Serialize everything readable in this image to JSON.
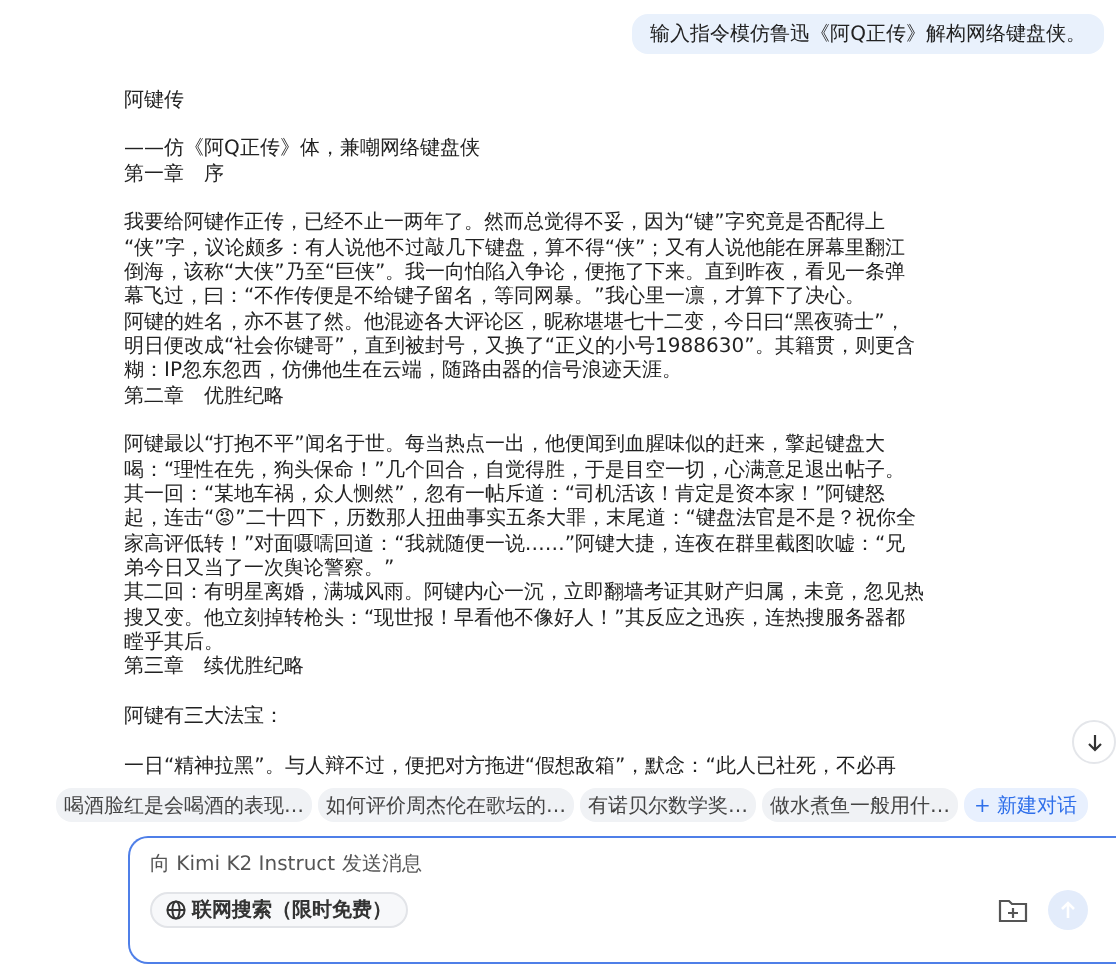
{
  "user_message": {
    "text": "输入指令模仿鲁迅《阿Q正传》解构网络键盘侠。"
  },
  "reply": [
    {
      "kind": "title",
      "text": "阿键传"
    },
    {
      "kind": "blank"
    },
    {
      "kind": "line",
      "text": "——仿《阿Q正传》体，兼嘲网络键盘侠"
    },
    {
      "kind": "chapter",
      "text": "第一章　序"
    },
    {
      "kind": "blank"
    },
    {
      "kind": "paragraph",
      "lines": [
        "我要给阿键作正传，已经不止一两年了。然而总觉得不妥，因为“键”字究竟是否配得上",
        "“侠”字，议论颇多：有人说他不过敲几下键盘，算不得“侠”；又有人说他能在屏幕里翻江",
        "倒海，该称“大侠”乃至“巨侠”。我一向怕陷入争论，便拖了下来。直到昨夜，看见一条弹",
        "幕飞过，曰：“不作传便是不给键子留名，等同网暴。”我心里一凛，才算下了决心。"
      ]
    },
    {
      "kind": "paragraph",
      "lines": [
        "阿键的姓名，亦不甚了然。他混迹各大评论区，昵称堪堪七十二变，今日曰“黑夜骑士”，",
        "明日便改成“社会你键哥”，直到被封号，又换了“正义的小号1988630”。其籍贯，则更含",
        "糊：IP忽东忽西，仿佛他生在云端，随路由器的信号浪迹天涯。"
      ]
    },
    {
      "kind": "chapter",
      "text": "第二章　优胜纪略"
    },
    {
      "kind": "blank"
    },
    {
      "kind": "paragraph",
      "lines": [
        "阿键最以“打抱不平”闻名于世。每当热点一出，他便闻到血腥味似的赶来，擎起键盘大",
        "喝：“理性在先，狗头保命！”几个回合，自觉得胜，于是目空一切，心满意足退出帖子。"
      ]
    },
    {
      "kind": "paragraph",
      "lines": [
        "其一回：“某地车祸，众人恻然”，忽有一帖斥道：“司机活该！肯定是资本家！”阿键怒",
        "起，连击“😡”二十四下，历数那人扭曲事实五条大罪，末尾道：“键盘法官是不是？祝你全",
        "家高评低转！”对面嗫嚅回道：“我就随便一说……”阿键大捷，连夜在群里截图吹嘘：“兄",
        "弟今日又当了一次舆论警察。”"
      ]
    },
    {
      "kind": "paragraph",
      "lines": [
        "其二回：有明星离婚，满城风雨。阿键内心一沉，立即翻墙考证其财产归属，未竟，忽见热",
        "搜又变。他立刻掉转枪头：“现世报！早看他不像好人！”其反应之迅疾，连热搜服务器都",
        "瞠乎其后。"
      ]
    },
    {
      "kind": "chapter",
      "text": "第三章　续优胜纪略"
    },
    {
      "kind": "blank"
    },
    {
      "kind": "line",
      "text": "阿键有三大法宝："
    },
    {
      "kind": "blank"
    },
    {
      "kind": "line",
      "text": "一日“精神拉黑”。与人辩不过，便把对方拖进“假想敌箱”，默念：“此人已社死，不必再"
    }
  ],
  "suggestions": [
    {
      "text": "喝酒脸红是会喝酒的表现…"
    },
    {
      "text": "如何评价周杰伦在歌坛的…"
    },
    {
      "text": "有诺贝尔数学奖…"
    },
    {
      "text": "做水煮鱼一般用什…"
    }
  ],
  "new_chat": {
    "label": "+ 新建对话"
  },
  "composer": {
    "placeholder": "向 Kimi K2 Instruct 发送消息",
    "search_button": "联网搜索（限时免费）"
  }
}
